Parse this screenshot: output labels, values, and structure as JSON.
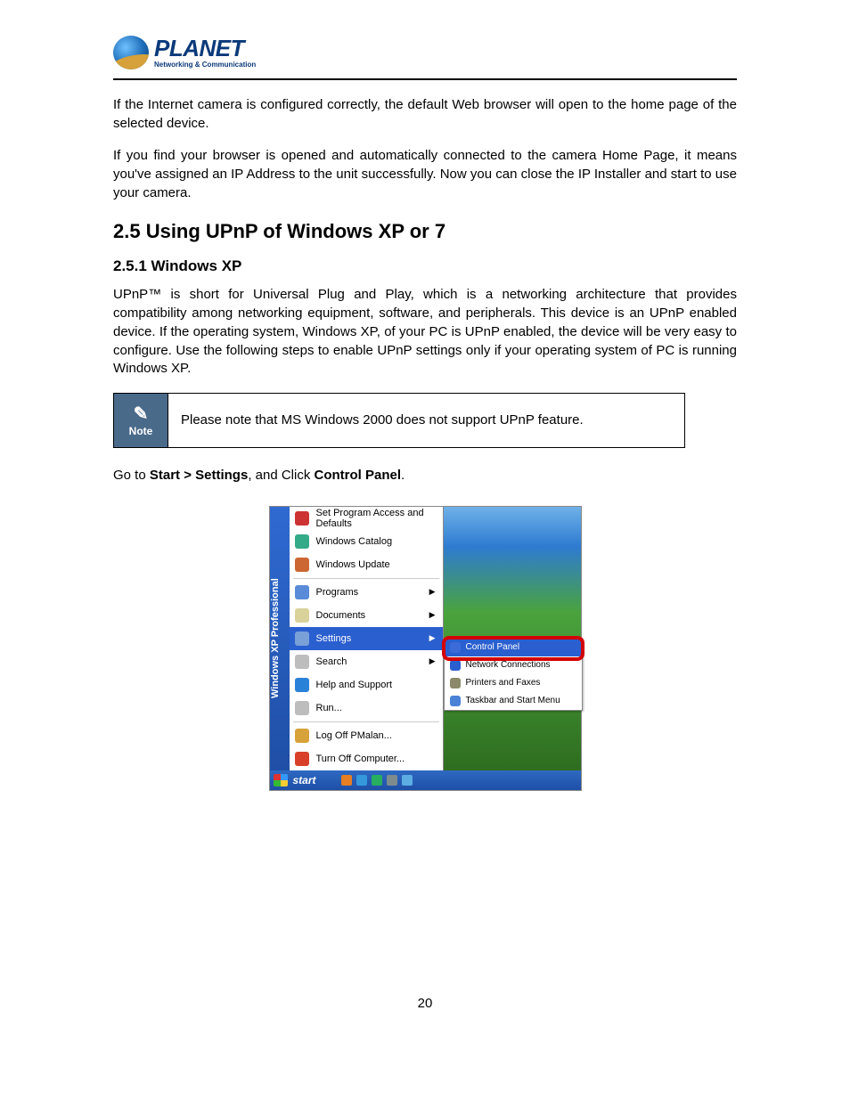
{
  "logo": {
    "brand": "PLANET",
    "tagline": "Networking & Communication"
  },
  "p1": "If the Internet camera is configured correctly, the default Web browser will open to the home page of the selected device.",
  "p2": "If you find your browser is opened and automatically connected to the camera Home Page, it means you've assigned an IP Address to the unit successfully. Now you can close the IP Installer and start to use your camera.",
  "h2": "2.5 Using UPnP of Windows XP or 7",
  "h3": "2.5.1 Windows XP",
  "p3": "UPnP™ is short for Universal Plug and Play, which is a networking architecture that provides compatibility among networking equipment, software, and peripherals. This device is an UPnP enabled device. If the operating system, Windows XP, of your PC is UPnP enabled, the device will be very easy to configure. Use the following steps to enable UPnP settings only if your operating system of PC is running Windows XP.",
  "note": {
    "label": "Note",
    "text": "Please note that MS Windows 2000 does not support UPnP feature."
  },
  "instr": {
    "pre": "Go to ",
    "b1": "Start > Settings",
    "mid": ", and Click ",
    "b2": "Control Panel",
    "post": "."
  },
  "startmenu": {
    "sidebar": "Windows XP Professional",
    "items": [
      {
        "label": "Set Program Access and Defaults",
        "icon": "#c33",
        "arrow": false
      },
      {
        "label": "Windows Catalog",
        "icon": "#3a8",
        "arrow": false
      },
      {
        "label": "Windows Update",
        "icon": "#c63",
        "arrow": false
      }
    ],
    "items2": [
      {
        "label": "Programs",
        "icon": "#5a8bd8",
        "arrow": true
      },
      {
        "label": "Documents",
        "icon": "#d9d29a",
        "arrow": true
      },
      {
        "label": "Settings",
        "icon": "#7aa0d8",
        "arrow": true,
        "selected": true
      },
      {
        "label": "Search",
        "icon": "#bdbdbd",
        "arrow": true
      },
      {
        "label": "Help and Support",
        "icon": "#2a82d8",
        "arrow": false
      },
      {
        "label": "Run...",
        "icon": "#bdbdbd",
        "arrow": false
      }
    ],
    "items3": [
      {
        "label": "Log Off PMalan...",
        "icon": "#d8a23a",
        "arrow": false
      },
      {
        "label": "Turn Off Computer...",
        "icon": "#d8402a",
        "arrow": false
      }
    ],
    "submenu": [
      {
        "label": "Control Panel",
        "icon": "#3a6bd8",
        "selected": true
      },
      {
        "label": "Network Connections",
        "icon": "#2a5fcf",
        "selected": false
      },
      {
        "label": "Printers and Faxes",
        "icon": "#8a8a6a",
        "selected": false
      },
      {
        "label": "Taskbar and Start Menu",
        "icon": "#4a82d8",
        "selected": false
      }
    ],
    "taskbar": {
      "start": "start"
    }
  },
  "page_number": "20"
}
